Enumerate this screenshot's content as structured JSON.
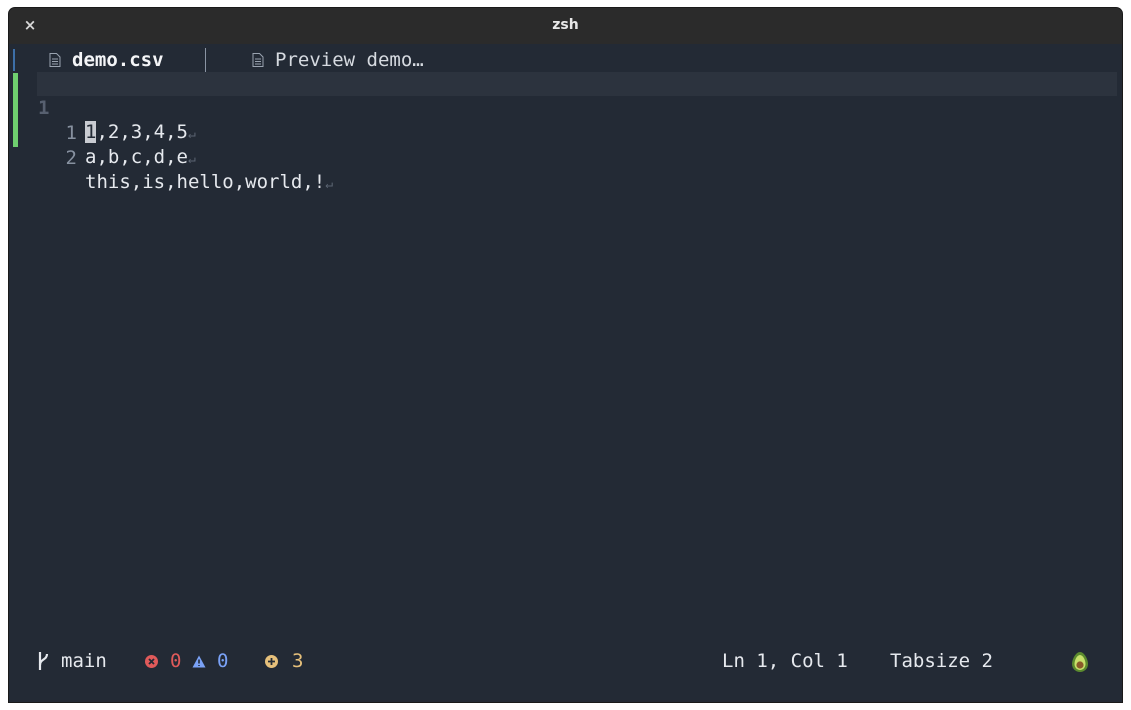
{
  "window": {
    "title": "zsh",
    "close_glyph": "×"
  },
  "tabs": [
    {
      "label": "demo.csv",
      "active": true,
      "icon": "file-icon"
    },
    {
      "label": "Preview demo…",
      "active": false,
      "icon": "file-icon"
    }
  ],
  "editor": {
    "current_line": {
      "number": "1",
      "cursor_char": "1",
      "rest": ",2,3,4,5"
    },
    "lines": [
      {
        "number": "1",
        "text": "a,b,c,d,e"
      },
      {
        "number": "2",
        "text": "this,is,hello,world,!"
      }
    ],
    "eol_glyph": "↵"
  },
  "status": {
    "branch": "main",
    "errors": "0",
    "warnings": "0",
    "hints": "3",
    "cursor": "Ln 1, Col 1",
    "tabsize": "Tabsize 2",
    "colors": {
      "error": "#e05a5a",
      "warning": "#7aa2f7",
      "hint": "#e6c07b",
      "diff_added": "#6fcf6f"
    }
  }
}
